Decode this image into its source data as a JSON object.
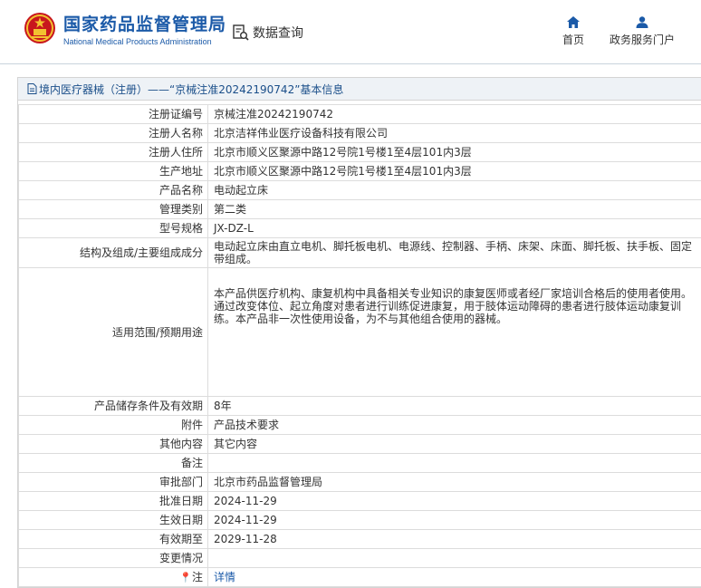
{
  "header": {
    "brand_cn": "国家药品监督管理局",
    "brand_en": "National Medical Products Administration",
    "query_label": "数据查询",
    "nav": {
      "home": "首页",
      "service": "政务服务门户"
    }
  },
  "breadcrumb": "境内医疗器械（注册）——“京械注准20242190742”基本信息",
  "rows": [
    {
      "label": "注册证编号",
      "value": "京械注准20242190742"
    },
    {
      "label": "注册人名称",
      "value": "北京洁祥伟业医疗设备科技有限公司"
    },
    {
      "label": "注册人住所",
      "value": "北京市顺义区聚源中路12号院1号楼1至4层101内3层"
    },
    {
      "label": "生产地址",
      "value": "北京市顺义区聚源中路12号院1号楼1至4层101内3层"
    },
    {
      "label": "产品名称",
      "value": "电动起立床"
    },
    {
      "label": "管理类别",
      "value": "第二类"
    },
    {
      "label": "型号规格",
      "value": "JX-DZ-L"
    },
    {
      "label": "结构及组成/主要组成成分",
      "value": "电动起立床由直立电机、脚托板电机、电源线、控制器、手柄、床架、床面、脚托板、扶手板、固定带组成。"
    },
    {
      "label": "适用范围/预期用途",
      "value": "本产品供医疗机构、康复机构中具备相关专业知识的康复医师或者经厂家培训合格后的使用者使用。通过改变体位、起立角度对患者进行训练促进康复，用于肢体运动障碍的患者进行肢体运动康复训练。本产品非一次性使用设备，为不与其他组合使用的器械。"
    },
    {
      "label": "产品储存条件及有效期",
      "value": "8年"
    },
    {
      "label": "附件",
      "value": "产品技术要求"
    },
    {
      "label": "其他内容",
      "value": "其它内容"
    },
    {
      "label": "备注",
      "value": ""
    },
    {
      "label": "审批部门",
      "value": "北京市药品监督管理局"
    },
    {
      "label": "批准日期",
      "value": "2024-11-29"
    },
    {
      "label": "生效日期",
      "value": "2024-11-29"
    },
    {
      "label": "有效期至",
      "value": "2029-11-28"
    },
    {
      "label": "变更情况",
      "value": ""
    },
    {
      "label": "注",
      "value": "详情"
    }
  ],
  "colors": {
    "brand": "#1b5aa8",
    "title_bg": "#eef2f6",
    "emblem_red": "#c8161d",
    "emblem_gold": "#f2c230"
  }
}
